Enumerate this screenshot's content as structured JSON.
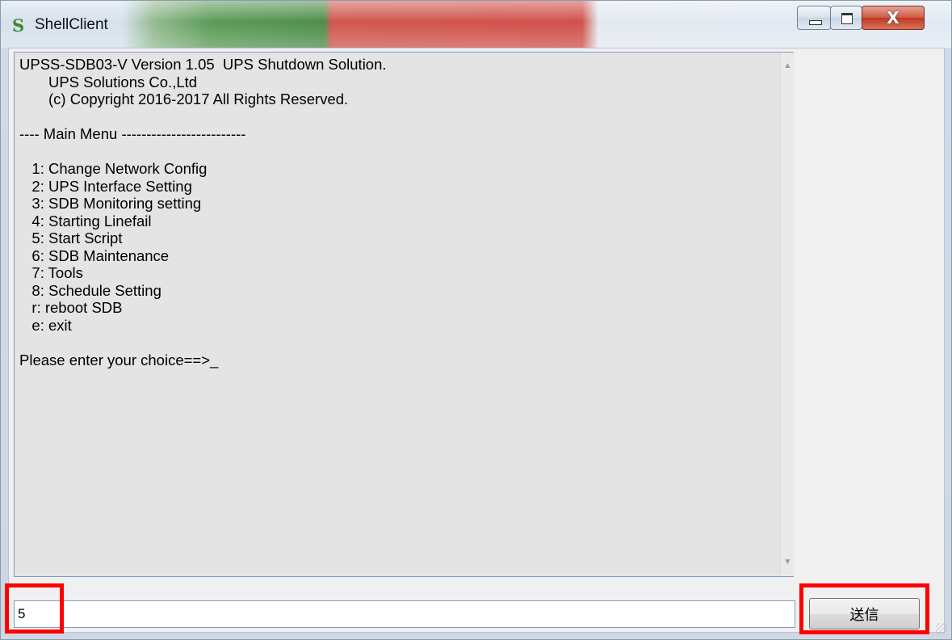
{
  "window": {
    "title": "ShellClient",
    "close_symbol": "X"
  },
  "terminal": {
    "lines": "UPSS-SDB03-V Version 1.05  UPS Shutdown Solution.\n       UPS Solutions Co.,Ltd\n       (c) Copyright 2016-2017 All Rights Reserved.\n\n---- Main Menu -------------------------\n\n   1: Change Network Config\n   2: UPS Interface Setting\n   3: SDB Monitoring setting\n   4: Starting Linefail\n   5: Start Script\n   6: SDB Maintenance\n   7: Tools\n   8: Schedule Setting\n   r: reboot SDB\n   e: exit\n\nPlease enter your choice==>_"
  },
  "input": {
    "value": "5"
  },
  "send_button": {
    "label": "送信"
  },
  "highlight_color": "#ff0000",
  "icons": {
    "app": "shellclient-s-icon",
    "minimize": "minimize-icon",
    "maximize": "maximize-icon",
    "close": "close-icon"
  }
}
